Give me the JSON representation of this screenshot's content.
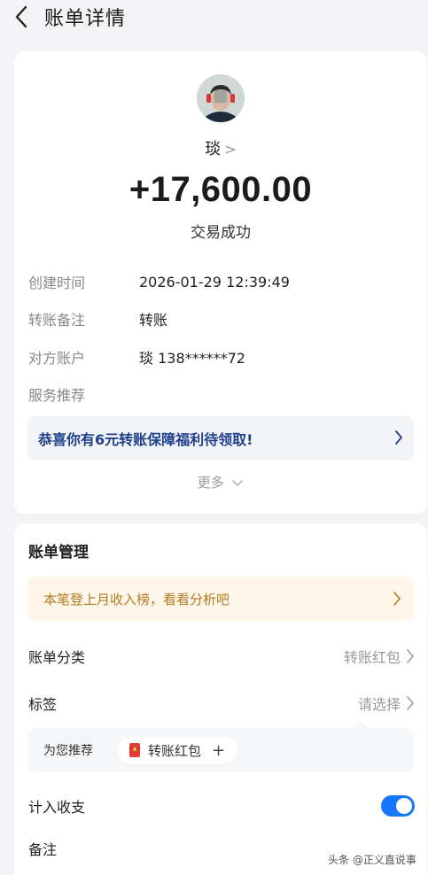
{
  "header": {
    "title": "账单详情"
  },
  "payee": {
    "name": "琰",
    "chevron": ">"
  },
  "transaction": {
    "amount": "+17,600.00",
    "status": "交易成功"
  },
  "details": [
    {
      "label": "创建时间",
      "value": "2026-01-29 12:39:49"
    },
    {
      "label": "转账备注",
      "value": "转账"
    },
    {
      "label": "对方账户",
      "value": "琰 138******72"
    },
    {
      "label": "服务推荐",
      "value": ""
    }
  ],
  "promo": {
    "text": "恭喜你有6元转账保障福利待领取!"
  },
  "more": {
    "label": "更多"
  },
  "management": {
    "title": "账单管理",
    "tip": "本笔登上月收入榜，看看分析吧",
    "category": {
      "label": "账单分类",
      "value": "转账红包"
    },
    "tags": {
      "label": "标签",
      "value": "请选择"
    },
    "recommend": {
      "label": "为您推荐",
      "chip": "转账红包",
      "plus": "+"
    },
    "count_in": {
      "label": "计入收支",
      "enabled": true
    },
    "note": {
      "label": "备注"
    }
  },
  "watermark": "头条 @正义直说事",
  "colors": {
    "accent": "#1677ff",
    "promo_text": "#1d3f8c",
    "tip_text": "#b67a24",
    "tip_bg": "#fdf6e9"
  }
}
